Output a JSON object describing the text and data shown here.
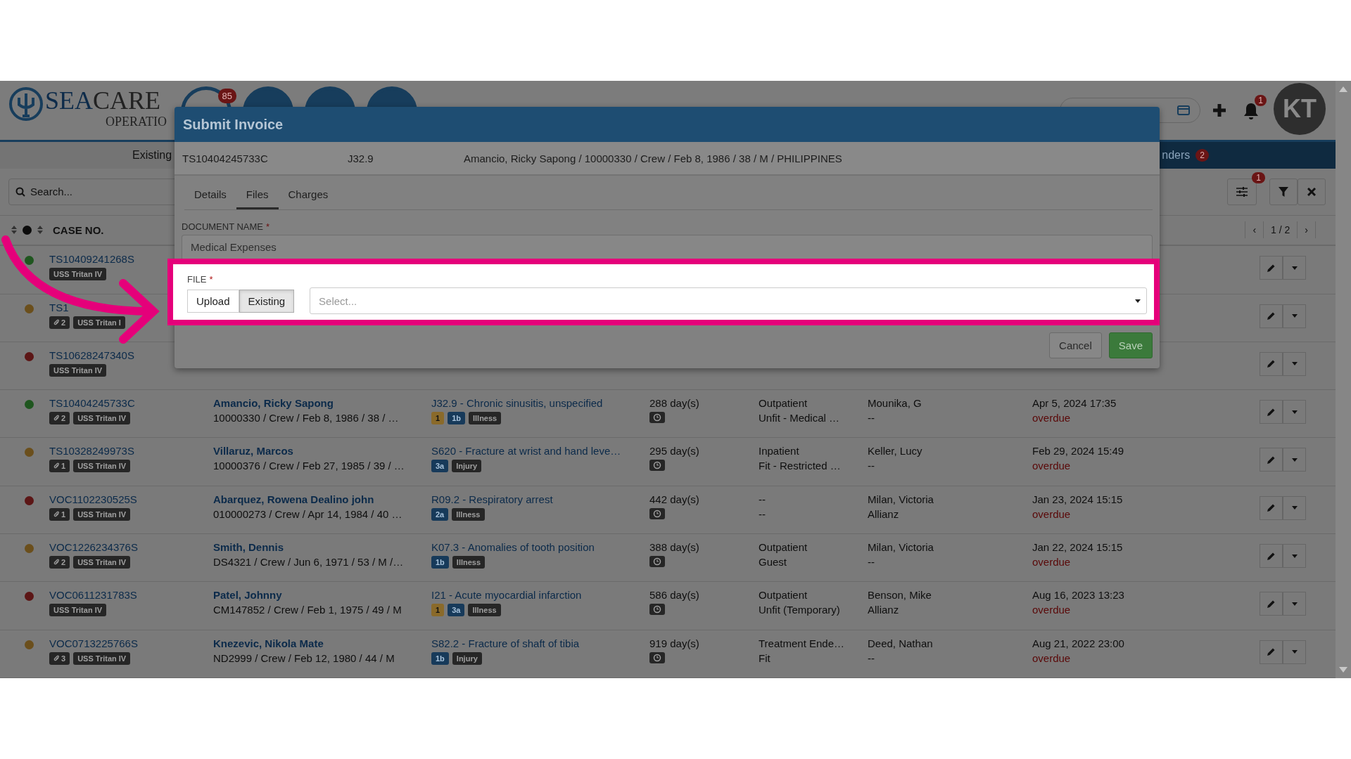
{
  "header": {
    "logo_1": "SEA",
    "logo_2": "CARE",
    "logo_sub": "OPERATIO",
    "nav_badge": "85",
    "notification_badge": "1",
    "avatar": "KT"
  },
  "nav": {
    "left_tab": "Existing",
    "right_tab": "nders",
    "right_badge": "2"
  },
  "toolbar": {
    "search_placeholder": "Search...",
    "settings_badge": "1"
  },
  "table": {
    "column_1": "CASE NO.",
    "pagination": {
      "prev": "‹",
      "page": "1 / 2",
      "next": "›"
    },
    "rows": [
      {
        "case": "TS10409241268S",
        "color": "#1f561f",
        "tags": [
          {
            "kind": "vessel",
            "label": "USS Tritan IV"
          }
        ]
      },
      {
        "case": "TS1",
        "color": "#6b4f1c",
        "tags": [
          {
            "kind": "files",
            "label": "2"
          },
          {
            "kind": "vessel",
            "label": "USS Tritan I"
          }
        ]
      },
      {
        "case": "TS10628247340S",
        "color": "#5c1616",
        "tags": [
          {
            "kind": "vessel",
            "label": "USS Tritan IV"
          }
        ]
      },
      {
        "case": "TS10404245733C",
        "color": "#1f561f",
        "tags": [
          {
            "kind": "files",
            "label": "2"
          },
          {
            "kind": "vessel",
            "label": "USS Tritan IV"
          }
        ],
        "patient": "Amancio, Ricky Sapong",
        "details": "10000330 / Crew / Feb 8, 1986 / 38 / …",
        "diagnosis": "J32.9 - Chronic sinusitis, unspecified",
        "diag_tags": [
          {
            "kind": "count",
            "label": "1"
          },
          {
            "kind": "grade",
            "label": "1b"
          },
          {
            "kind": "type",
            "label": "Illness"
          }
        ],
        "days": "288 day(s)",
        "care": "Outpatient",
        "fitness": "Unfit - Medical …",
        "doctor": "Mounika, G",
        "insurer": "--",
        "date": "Apr 5, 2024 17:35",
        "due": "overdue"
      },
      {
        "case": "TS10328249973S",
        "color": "#6b4f1c",
        "tags": [
          {
            "kind": "files",
            "label": "1"
          },
          {
            "kind": "vessel",
            "label": "USS Tritan IV"
          }
        ],
        "patient": "Villaruz, Marcos",
        "details": "10000376 / Crew / Feb 27, 1985 / 39 / …",
        "diagnosis": "S620 - Fracture at wrist and hand leve…",
        "diag_tags": [
          {
            "kind": "grade",
            "label": "3a"
          },
          {
            "kind": "type",
            "label": "Injury"
          }
        ],
        "days": "295 day(s)",
        "care": "Inpatient",
        "fitness": "Fit - Restricted …",
        "doctor": "Keller, Lucy",
        "insurer": "--",
        "date": "Feb 29, 2024 15:49",
        "due": "overdue"
      },
      {
        "case": "VOC1102230525S",
        "color": "#5c1616",
        "tags": [
          {
            "kind": "files",
            "label": "1"
          },
          {
            "kind": "vessel",
            "label": "USS Tritan IV"
          }
        ],
        "patient": "Abarquez, Rowena Dealino john",
        "details": "010000273 / Crew / Apr 14, 1984 / 40 …",
        "diagnosis": "R09.2 - Respiratory arrest",
        "diag_tags": [
          {
            "kind": "grade",
            "label": "2a"
          },
          {
            "kind": "type",
            "label": "Illness"
          }
        ],
        "days": "442 day(s)",
        "care": "--",
        "fitness": "--",
        "doctor": "Milan, Victoria",
        "insurer": "Allianz",
        "date": "Jan 23, 2024 15:15",
        "due": "overdue"
      },
      {
        "case": "VOC1226234376S",
        "color": "#6b4f1c",
        "tags": [
          {
            "kind": "files",
            "label": "2"
          },
          {
            "kind": "vessel",
            "label": "USS Tritan IV"
          }
        ],
        "patient": "Smith, Dennis",
        "details": "DS4321 / Crew / Jun 6, 1971 / 53 / M /…",
        "diagnosis": "K07.3 - Anomalies of tooth position",
        "diag_tags": [
          {
            "kind": "grade",
            "label": "1b"
          },
          {
            "kind": "type",
            "label": "Illness"
          }
        ],
        "days": "388 day(s)",
        "care": "Outpatient",
        "fitness": "Guest",
        "doctor": "Milan, Victoria",
        "insurer": "--",
        "date": "Jan 22, 2024 15:15",
        "due": "overdue"
      },
      {
        "case": "VOC0611231783S",
        "color": "#5c1616",
        "tags": [
          {
            "kind": "vessel",
            "label": "USS Tritan IV"
          }
        ],
        "patient": "Patel, Johnny",
        "details": "CM147852 / Crew / Feb 1, 1975 / 49 / M",
        "diagnosis": "I21 - Acute myocardial infarction",
        "diag_tags": [
          {
            "kind": "count",
            "label": "1"
          },
          {
            "kind": "grade",
            "label": "3a"
          },
          {
            "kind": "type",
            "label": "Illness"
          }
        ],
        "days": "586 day(s)",
        "care": "Outpatient",
        "fitness": "Unfit (Temporary)",
        "doctor": "Benson, Mike",
        "insurer": "Allianz",
        "date": "Aug 16, 2023 13:23",
        "due": "overdue"
      },
      {
        "case": "VOC0713225766S",
        "color": "#6b4f1c",
        "tags": [
          {
            "kind": "files",
            "label": "3"
          },
          {
            "kind": "vessel",
            "label": "USS Tritan IV"
          }
        ],
        "patient": "Knezevic, Nikola Mate",
        "details": "ND2999 / Crew / Feb 12, 1980 / 44 / M",
        "diagnosis": "S82.2 - Fracture of shaft of tibia",
        "diag_tags": [
          {
            "kind": "grade",
            "label": "1b"
          },
          {
            "kind": "type",
            "label": "Injury"
          }
        ],
        "days": "919 day(s)",
        "care": "Treatment Ende…",
        "fitness": "Fit",
        "doctor": "Deed, Nathan",
        "insurer": "--",
        "date": "Aug 21, 2022 23:00",
        "due": "overdue"
      }
    ]
  },
  "modal": {
    "title": "Submit Invoice",
    "case": "TS10404245733C",
    "code": "J32.9",
    "patient": "Amancio, Ricky Sapong / 10000330 / Crew / Feb 8, 1986 / 38 / M / PHILIPPINES",
    "tabs": [
      {
        "label": "Details",
        "selected": false
      },
      {
        "label": "Files",
        "selected": true
      },
      {
        "label": "Charges",
        "selected": false
      }
    ],
    "document_label": "DOCUMENT NAME",
    "document_value": "Medical Expenses",
    "required_mark": "*",
    "file_label": "FILE",
    "file_required_mark": "*",
    "sources": [
      {
        "label": "Upload",
        "selected": false
      },
      {
        "label": "Existing",
        "selected": true
      }
    ],
    "select_placeholder": "Select...",
    "buttons": [
      {
        "kind": "cancel",
        "label": "Cancel"
      },
      {
        "kind": "save",
        "label": "Save"
      }
    ]
  }
}
